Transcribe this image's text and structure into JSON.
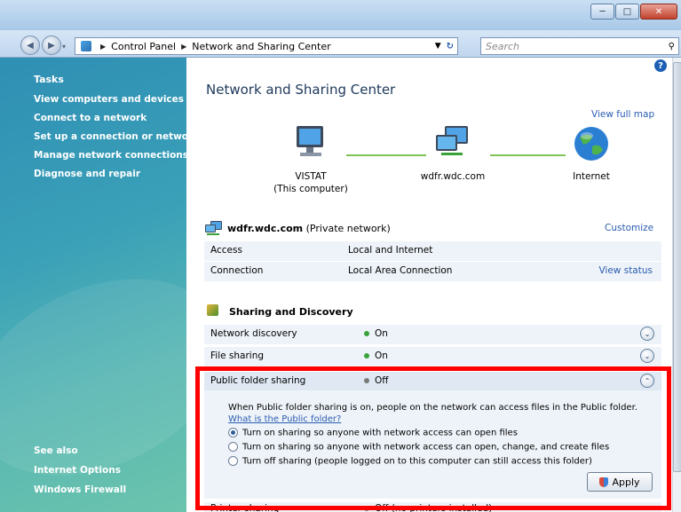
{
  "window": {
    "minimize": "─",
    "maximize": "□",
    "close": "✕"
  },
  "address": {
    "crumbs": [
      "Control Panel",
      "Network and Sharing Center"
    ],
    "search_placeholder": "Search"
  },
  "sidebar": {
    "tasks_heading": "Tasks",
    "tasks": [
      "View computers and devices",
      "Connect to a network",
      "Set up a connection or network",
      "Manage network connections",
      "Diagnose and repair"
    ],
    "see_also_heading": "See also",
    "see_also": [
      "Internet Options",
      "Windows Firewall"
    ]
  },
  "main": {
    "title": "Network and Sharing Center",
    "view_full_map": "View full map",
    "map": {
      "computer_name": "VISTAT",
      "computer_sub": "(This computer)",
      "network": "wdfr.wdc.com",
      "internet": "Internet"
    },
    "network_header": {
      "name": "wdfr.wdc.com",
      "type": " (Private network)",
      "customize": "Customize"
    },
    "details": [
      {
        "label": "Access",
        "value": "Local and Internet",
        "action": ""
      },
      {
        "label": "Connection",
        "value": "Local Area Connection",
        "action": "View status"
      }
    ],
    "sharing_heading": "Sharing and Discovery",
    "sharing": [
      {
        "label": "Network discovery",
        "status": "On",
        "color": "#3aa23a"
      },
      {
        "label": "File sharing",
        "status": "On",
        "color": "#3aa23a"
      },
      {
        "label": "Public folder sharing",
        "status": "Off",
        "color": "#7a7a7a"
      },
      {
        "label": "Printer sharing",
        "status": "Off (no printers installed)",
        "color": "#7a7a7a"
      }
    ],
    "public_desc": "When Public folder sharing is on, people on the network can access files in the Public folder.",
    "public_link": "What is the Public folder?",
    "options": [
      "Turn on sharing so anyone with network access can open files",
      "Turn on sharing so anyone with network access can open, change, and create files",
      "Turn off sharing (people logged on to this computer can still access this folder)"
    ],
    "apply": "Apply"
  }
}
